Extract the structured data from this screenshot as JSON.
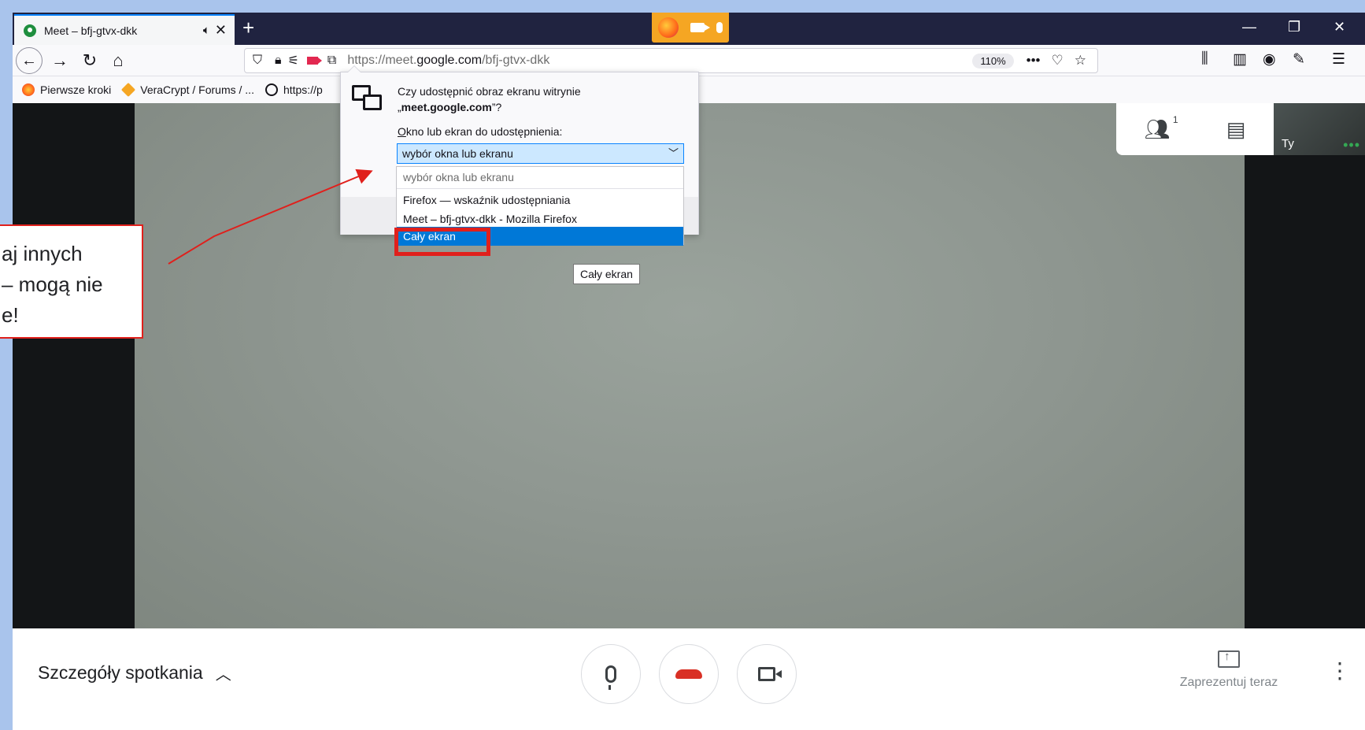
{
  "browser": {
    "tab": {
      "title": "Meet – bfj-gtvx-dkk",
      "audio_icon": "speaker-icon",
      "close_icon": "close-icon"
    },
    "new_tab_label": "+",
    "window_controls": {
      "minimize": "—",
      "restore": "❐",
      "close": "✕"
    },
    "url": {
      "prefix": "https://meet.",
      "domain": "google.com",
      "path": "/bfj-gtvx-dkk"
    },
    "zoom": "110%",
    "bookmarks": [
      {
        "label": "Pierwsze kroki",
        "icon": "firefox-icon"
      },
      {
        "label": "VeraCrypt / Forums / ...",
        "icon": "veracrypt-icon"
      },
      {
        "label": "https://p",
        "icon": "globe-icon"
      }
    ]
  },
  "share_dialog": {
    "question_line1": "Czy udostępnić obraz ekranu witrynie",
    "question_quote_open": "„",
    "question_site": "meet.google.com",
    "question_quote_close": "”?",
    "label_mnemonic": "O",
    "label_rest": "kno lub ekran do udostępnienia:",
    "selected": "wybór okna lub ekranu",
    "options": [
      "wybór okna lub ekranu",
      "Firefox — wskaźnik udostępniania",
      "Meet – bfj-gtvx-dkk - Mozilla Firefox",
      "Cały ekran"
    ],
    "tooltip": "Cały ekran"
  },
  "meet": {
    "self_label": "Ty",
    "people_count": "1",
    "meeting_details": "Szczegóły spotkania",
    "present_label": "Zaprezentuj teraz"
  },
  "annotation": {
    "callout_lines": [
      "aj innych",
      "– mogą nie",
      "e!"
    ]
  },
  "colors": {
    "tabstrip": "#202340",
    "sharing_indicator": "#f5a623",
    "annotation_red": "#e0201c",
    "selected_option": "#0078d7",
    "hangup_red": "#d93025"
  }
}
